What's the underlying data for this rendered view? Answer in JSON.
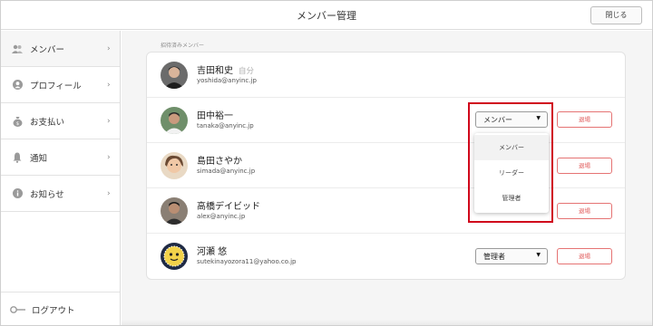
{
  "header": {
    "title": "メンバー管理",
    "close_label": "閉じる"
  },
  "sidebar": {
    "items": [
      {
        "label": "メンバー",
        "icon": "members-icon"
      },
      {
        "label": "プロフィール",
        "icon": "profile-icon"
      },
      {
        "label": "お支払い",
        "icon": "money-bag-icon"
      },
      {
        "label": "通知",
        "icon": "bell-icon"
      },
      {
        "label": "お知らせ",
        "icon": "info-icon"
      }
    ],
    "logout_label": "ログアウト"
  },
  "main": {
    "section_label": "招待済みメンバー",
    "self_tag": "自分",
    "leave_label": "退場",
    "members": [
      {
        "name": "吉田和史",
        "email": "yoshida@anyinc.jp"
      },
      {
        "name": "田中裕一",
        "email": "tanaka@anyinc.jp",
        "role": "メンバー"
      },
      {
        "name": "島田さやか",
        "email": "simada@anyinc.jp"
      },
      {
        "name": "高橋デイビッド",
        "email": "alex@anyinc.jp"
      },
      {
        "name": "河瀬 悠",
        "email": "sutekinayozora11@yahoo.co.jp",
        "role": "管理者"
      }
    ],
    "role_options": [
      "メンバー",
      "リーダー",
      "管理者"
    ]
  },
  "colors": {
    "danger": "#e05555",
    "highlight": "#d0021b"
  }
}
